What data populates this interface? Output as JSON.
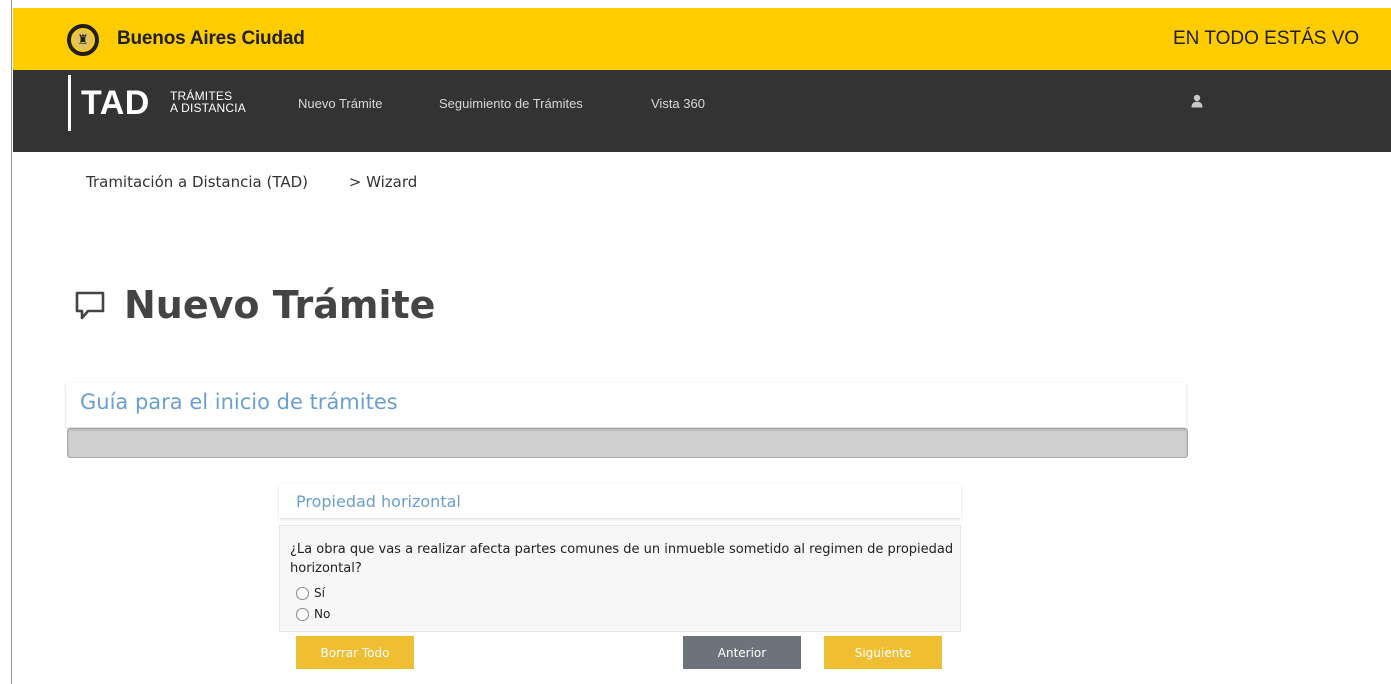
{
  "header": {
    "brand_name": "Buenos Aires Ciudad",
    "slogan": "EN TODO ESTÁS VO"
  },
  "navbar": {
    "logo_text": "TAD",
    "logo_sub_line1": "TRÁMITES",
    "logo_sub_line2": "A DISTANCIA",
    "links": [
      "Nuevo Trámite",
      "Seguimiento de Trámites",
      "Vista 360"
    ]
  },
  "breadcrumb": {
    "root": "Tramitación a Distancia (TAD)",
    "current": "> Wizard"
  },
  "page": {
    "title": "Nuevo Trámite"
  },
  "guide": {
    "title": "Guía para el inicio de trámites",
    "progress_percent": 0
  },
  "section": {
    "title": "Propiedad horizontal",
    "question": "¿La obra que vas a realizar afecta partes comunes de un inmueble sometido al regimen de propiedad horizontal?",
    "options": [
      "Sí",
      "No"
    ]
  },
  "buttons": {
    "clear": "Borrar Todo",
    "previous": "Anterior",
    "next": "Siguiente"
  },
  "colors": {
    "topbar": "#ffcc00",
    "navbar": "#333333",
    "accent_blue": "#6a9fd0",
    "button_yellow": "#f0be33",
    "button_gray": "#6c737b"
  },
  "icons": {
    "brand": "buenos-aires-shield-icon",
    "user": "user-icon",
    "page_title": "chat-bubble-icon"
  }
}
